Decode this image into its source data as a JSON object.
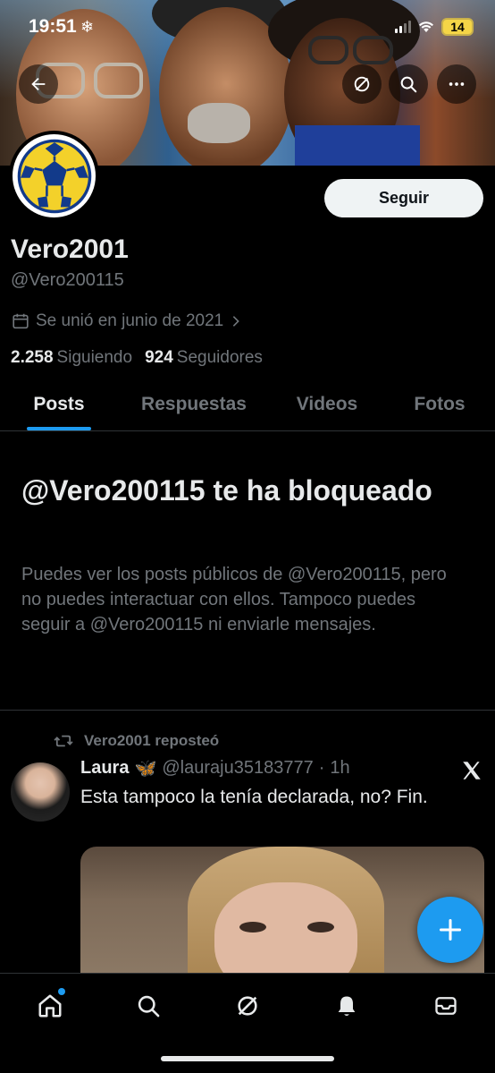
{
  "status_bar": {
    "time": "19:51",
    "extra_icon": "❄",
    "battery": "14"
  },
  "profile": {
    "display_name": "Vero2001",
    "handle": "@Vero200115",
    "joined": "Se unió en junio de 2021",
    "following_count": "2.258",
    "following_label": "Siguiendo",
    "followers_count": "924",
    "followers_label": "Seguidores",
    "follow_button": "Seguir"
  },
  "tabs": [
    {
      "label": "Posts",
      "active": true
    },
    {
      "label": "Respuestas",
      "active": false
    },
    {
      "label": "Videos",
      "active": false
    },
    {
      "label": "Fotos",
      "active": false
    }
  ],
  "blocked": {
    "title": "@Vero200115 te ha bloqueado",
    "body": "Puedes ver los posts públicos de @Vero200115, pero no puedes interactuar con ellos. Tampoco puedes seguir a @Vero200115 ni enviarle mensajes."
  },
  "tweet": {
    "repost_label": "Vero2001 reposteó",
    "author_name": "Laura",
    "author_emoji": "🦋",
    "author_handle": "@lauraju35183777",
    "separator": "·",
    "time": "1h",
    "text": "Esta tampoco la tenía declarada, no? Fin."
  },
  "colors": {
    "accent": "#1d9bf0",
    "background": "#000000",
    "secondary_text": "#71767b"
  },
  "icons": [
    "back-arrow-icon",
    "grok-icon",
    "search-icon",
    "more-icon",
    "calendar-icon",
    "chevron-right-icon",
    "repost-icon",
    "x-logo-icon",
    "plus-icon",
    "home-icon",
    "notifications-icon",
    "messages-icon"
  ]
}
